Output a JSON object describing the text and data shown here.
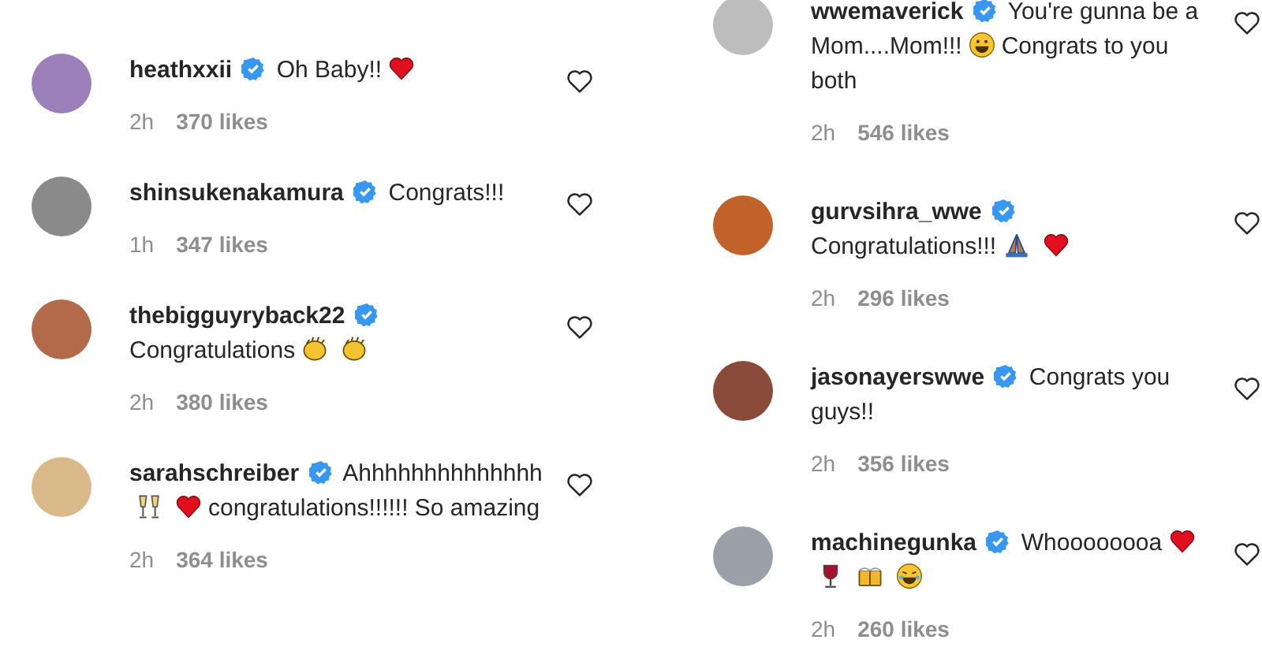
{
  "columns": [
    {
      "comments": [
        {
          "username": "heathxxii",
          "verified": true,
          "parts": [
            {
              "kind": "text",
              "text": "Oh Baby!!"
            },
            {
              "kind": "heart"
            }
          ],
          "time": "2h",
          "likes": "370 likes"
        },
        {
          "username": "shinsukenakamura",
          "verified": true,
          "parts": [
            {
              "kind": "text",
              "text": "Congrats!!!"
            }
          ],
          "time": "1h",
          "likes": "347 likes"
        },
        {
          "username": "thebigguyryback22",
          "verified": true,
          "parts": [
            {
              "kind": "text",
              "text": "Congratulations"
            },
            {
              "kind": "clap"
            },
            {
              "kind": "clap"
            }
          ],
          "time": "2h",
          "likes": "380 likes"
        },
        {
          "username": "sarahschreiber",
          "verified": true,
          "parts": [
            {
              "kind": "text",
              "text": "Ahhhhhhhhhhhhhh"
            },
            {
              "kind": "toast"
            },
            {
              "kind": "heart"
            },
            {
              "kind": "text",
              "text": "congratulations!!!!!! So amazing"
            }
          ],
          "time": "2h",
          "likes": "364 likes"
        }
      ]
    },
    {
      "comments": [
        {
          "username": "wwemaverick",
          "verified": true,
          "parts": [
            {
              "kind": "text",
              "text": "You're gunna be a Mom....Mom!!!"
            },
            {
              "kind": "grin"
            },
            {
              "kind": "text",
              "text": "Congrats to you both"
            }
          ],
          "time": "2h",
          "likes": "546 likes"
        },
        {
          "username": "gurvsihra_wwe",
          "verified": true,
          "parts": [
            {
              "kind": "text",
              "text": "Congratulations!!!"
            },
            {
              "kind": "pray"
            },
            {
              "kind": "heart"
            }
          ],
          "time": "2h",
          "likes": "296 likes"
        },
        {
          "username": "jasonayerswwe",
          "verified": true,
          "parts": [
            {
              "kind": "text",
              "text": "Congrats you guys!!"
            }
          ],
          "time": "2h",
          "likes": "356 likes"
        },
        {
          "username": "machinegunka",
          "verified": true,
          "parts": [
            {
              "kind": "text",
              "text": "Whoooooooa"
            },
            {
              "kind": "heart"
            },
            {
              "kind": "wine"
            },
            {
              "kind": "beer"
            },
            {
              "kind": "laugh"
            }
          ],
          "time": "2h",
          "likes": "260 likes"
        }
      ]
    }
  ]
}
